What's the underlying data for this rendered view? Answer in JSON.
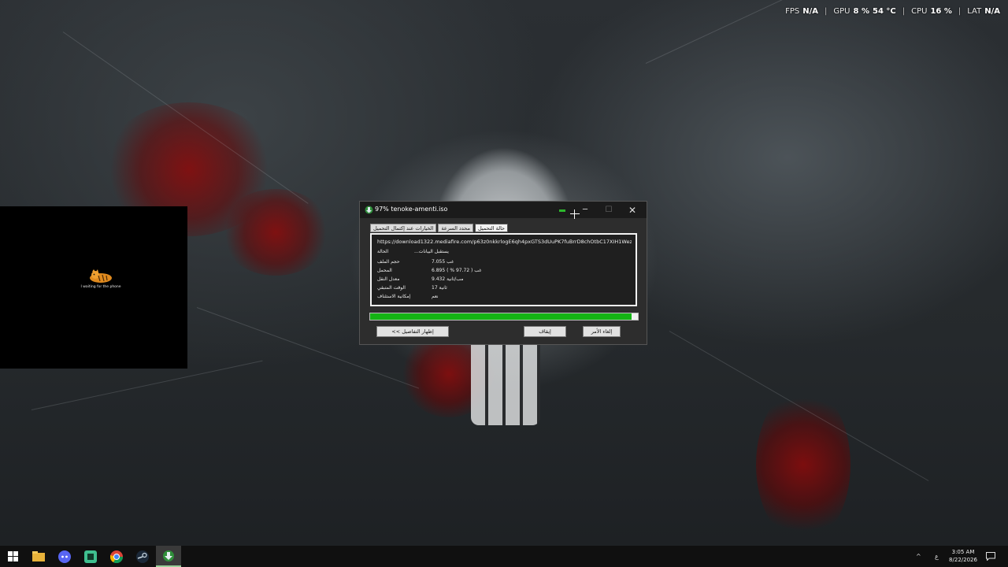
{
  "overlay": {
    "fps_label": "FPS",
    "fps_value": "N/A",
    "gpu_label": "GPU",
    "gpu_load": "8 %",
    "gpu_temp": "54 °C",
    "cpu_label": "CPU",
    "cpu_load": "16 %",
    "lat_label": "LAT",
    "lat_value": "N/A",
    "separator": "|"
  },
  "side_window": {
    "caption": "I waiting for the phone"
  },
  "dialog": {
    "title": "97% tenoke-amenti.iso",
    "tabs": [
      {
        "label": "حالة التحميل",
        "active": true
      },
      {
        "label": "محدد السرعة",
        "active": false
      },
      {
        "label": "الخيارات عند إكتمال التحميل",
        "active": false
      }
    ],
    "url": "https://download1322.mediafire.com/p63z0nkkrlogE6qh4pxGTS3dUuPK7fuBrrD8chOtbC17XIH1Wez8",
    "status_label": "الحالة",
    "status_value": "يستقبل البيانات...",
    "info": [
      {
        "label": "حجم الملف",
        "value": "7.055  غب"
      },
      {
        "label": "المحمل",
        "value": "6.895  غب  ( 97.72 % )"
      },
      {
        "label": "معدل النقل",
        "value": "9.432  مب/ثانية"
      },
      {
        "label": "الوقت المتبقي",
        "value": "17 ثانية"
      },
      {
        "label": "إمكانية الاستئناف",
        "value": "نعم"
      }
    ],
    "progress": 0.9772,
    "buttons": {
      "details": "<< إظهار التفاصيل",
      "pause": "إيقاف",
      "cancel": "إلغاء الأمر"
    },
    "window_controls": {
      "minimize": "─",
      "maximize": "☐",
      "close": "✕"
    }
  },
  "taskbar": {
    "items": [
      {
        "name": "start-icon",
        "glyph": "⊞"
      },
      {
        "name": "file-explorer-icon",
        "glyph": "📁"
      },
      {
        "name": "discord-icon",
        "glyph": "◉"
      },
      {
        "name": "app-icon",
        "glyph": "▣"
      },
      {
        "name": "chrome-icon",
        "glyph": "◎"
      },
      {
        "name": "steam-icon",
        "glyph": "⚙"
      },
      {
        "name": "idm-icon",
        "glyph": "⬇"
      }
    ],
    "tray_chevron": "^",
    "tray_lang": "ع",
    "clock_time": "3:05 AM",
    "clock_date": "8/22/2026"
  },
  "colors": {
    "progress_fill": "#14b414",
    "dialog_bg": "#2d2d2d",
    "taskbar_bg": "#101010"
  }
}
